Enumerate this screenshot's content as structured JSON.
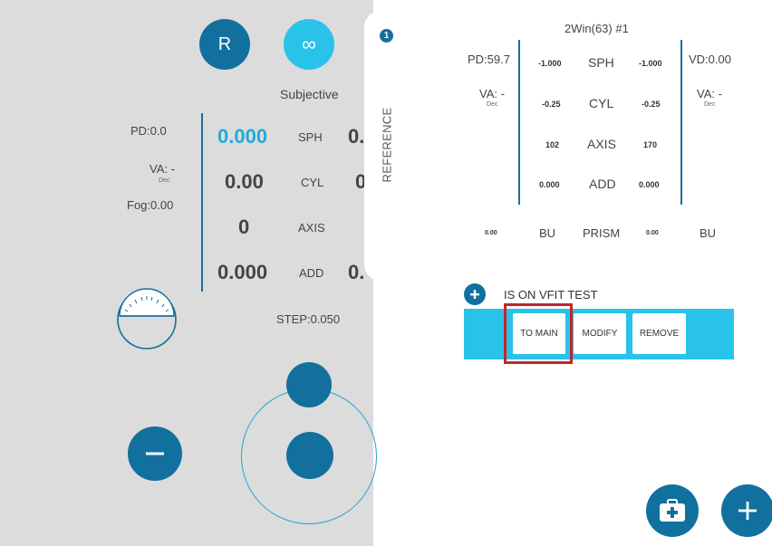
{
  "left": {
    "eye_button": "R",
    "infinity_button": "∞",
    "mode_label": "Subjective",
    "pd": "PD:0.0",
    "va": "VA: -",
    "va_sub": "Dec",
    "fog": "Fog:0.00",
    "sph_value": "0.000",
    "sph_label": "SPH",
    "sph_next": "0.",
    "cyl_value": "0.00",
    "cyl_label": "CYL",
    "cyl_next": "0",
    "axis_value": "0",
    "axis_label": "AXIS",
    "add_value": "0.000",
    "add_label": "ADD",
    "add_next": "0.",
    "step": "STEP:0.050"
  },
  "reference": {
    "tab_label": "REFERENCE",
    "tab_number": "1",
    "title": "2Win(63) #1",
    "pd": "PD:59.7",
    "vd": "VD:0.00",
    "va_left": "VA: -",
    "va_left_sub": "Dec",
    "va_right": "VA: -",
    "va_right_sub": "Dec",
    "rows": [
      {
        "left": "-1.000",
        "label": "SPH",
        "right": "-1.000"
      },
      {
        "left": "-0.25",
        "label": "CYL",
        "right": "-0.25"
      },
      {
        "left": "102",
        "label": "AXIS",
        "right": "170"
      },
      {
        "left": "0.000",
        "label": "ADD",
        "right": "0.000"
      }
    ],
    "prism": {
      "left_val": "0.00",
      "left_dir": "BU",
      "label": "PRISM",
      "right_val": "0.00",
      "right_dir": "BU"
    }
  },
  "vfit": {
    "status": "IS ON VFIT TEST",
    "buttons": [
      "TO MAIN",
      "MODIFY",
      "REMOVE"
    ]
  },
  "colors": {
    "dark_blue": "#12709f",
    "light_blue": "#29c3ea",
    "accent_text": "#23a9db",
    "highlight": "#c0272d"
  },
  "icons": {
    "minus": "minus-icon",
    "plus": "plus-icon",
    "medkit": "medical-kit-icon",
    "protractor": "protractor-icon"
  }
}
